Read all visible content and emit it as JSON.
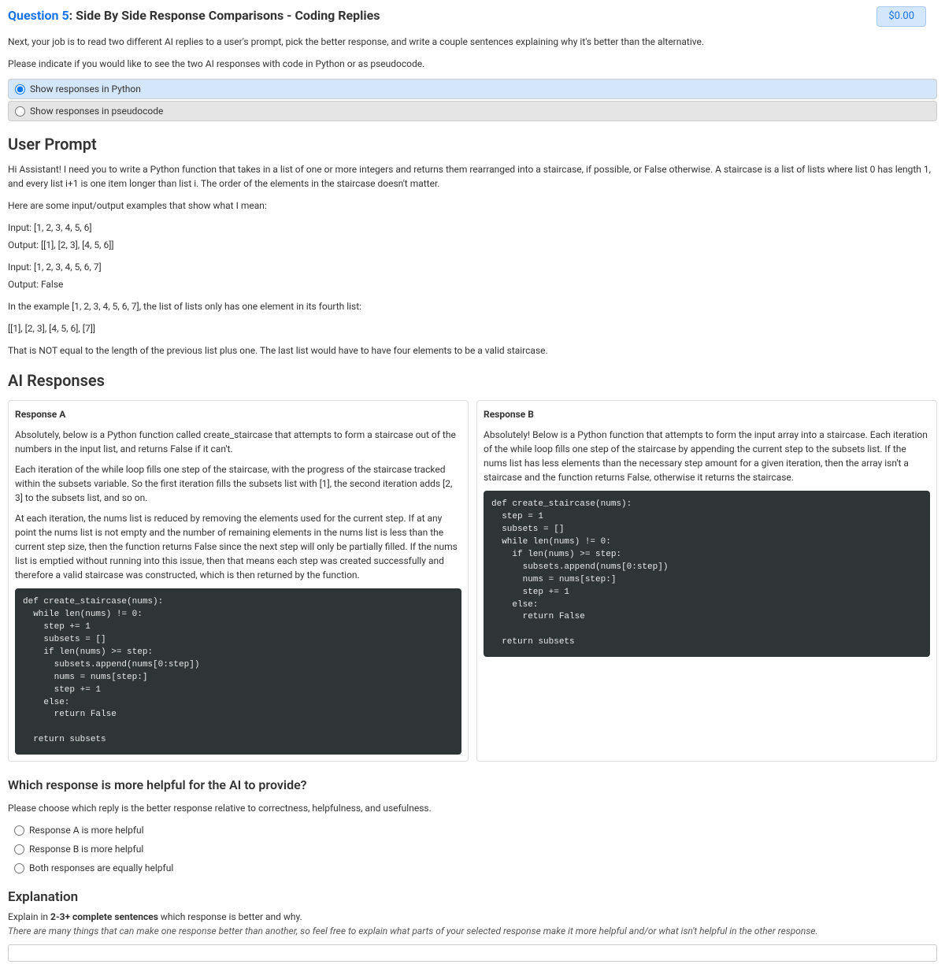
{
  "price": "$0.00",
  "question": {
    "number": "Question 5",
    "title": ": Side By Side Response Comparisons - Coding Replies"
  },
  "instructions": {
    "line1": "Next, your job is to read two different AI replies to a user's prompt, pick the better response, and write a couple sentences explaining why it's better than the alternative.",
    "line2": "Please indicate if you would like to see the two AI responses with code in Python or as pseudocode."
  },
  "codeFormatOptions": {
    "opt1": "Show responses in Python",
    "opt2": "Show responses in pseudocode"
  },
  "userPrompt": {
    "title": "User Prompt",
    "line1": "Hi Assistant! I need you to write a Python function that takes in a list of one or more integers and returns them rearranged into a staircase, if possible, or False otherwise. A staircase is a list of lists where list 0 has length 1, and every list i+1 is one item longer than list i. The order of the elements in the staircase doesn't matter.",
    "line2": "Here are some input/output examples that show what I mean:",
    "example1a": "Input: [1, 2, 3, 4, 5, 6]",
    "example1b": "Output: [[1], [2, 3], [4, 5, 6]]",
    "example2a": "Input: [1, 2, 3, 4, 5, 6, 7]",
    "example2b": "Output: False",
    "line3": "In the example [1, 2, 3, 4, 5, 6, 7], the list of lists only has one element in its fourth list:",
    "line4": "[[1], [2, 3], [4, 5, 6], [7]]",
    "line5": "That is NOT equal to the length of the previous list plus one. The last list would have to have four elements to be a valid staircase."
  },
  "aiResponses": {
    "title": "AI Responses",
    "responseA": {
      "header": "Response A",
      "p1": "Absolutely, below is a Python function called create_staircase that attempts to form a staircase out of the numbers in the input list, and returns False if it can't.",
      "p2": "Each iteration of the while loop fills one step of the staircase, with the progress of the staircase tracked within the subsets variable. So the first iteration fills the subsets list with [1], the second iteration adds [2, 3] to the subsets list, and so on.",
      "p3": "At each iteration, the nums list is reduced by removing the elements used for the current step. If at any point the nums list is not empty and the number of remaining elements in the nums list is less than the current step size, then the function returns False since the next step will only be partially filled. If the nums list is emptied without running into this issue, then that means each step was created successfully and therefore a valid staircase was constructed, which is then returned by the function.",
      "code": "def create_staircase(nums):\n  while len(nums) != 0:\n    step += 1\n    subsets = []\n    if len(nums) >= step:\n      subsets.append(nums[0:step])\n      nums = nums[step:]\n      step += 1\n    else:\n      return False\n\n  return subsets"
    },
    "responseB": {
      "header": "Response B",
      "p1": "Absolutely! Below is a Python function that attempts to form the input array into a staircase. Each iteration of the while loop fills one step of the staircase by appending the current step to the subsets list. If the nums list has less elements than the necessary step amount for a given iteration, then the array isn't a staircase and the function returns False, otherwise it returns the staircase.",
      "code": "def create_staircase(nums):\n  step = 1\n  subsets = []\n  while len(nums) != 0:\n    if len(nums) >= step:\n      subsets.append(nums[0:step])\n      nums = nums[step:]\n      step += 1\n    else:\n      return False\n\n  return subsets"
    }
  },
  "helpfulSection": {
    "question": "Which response is more helpful for the AI to provide?",
    "instruction": "Please choose which reply is the better response relative to correctness, helpfulness, and usefulness.",
    "optA": "Response A is more helpful",
    "optB": "Response B is more helpful",
    "optBoth": "Both responses are equally helpful"
  },
  "explanation": {
    "header": "Explanation",
    "line1a": "Explain in ",
    "line1b": "2-3+ complete sentences",
    "line1c": " which response is better and why.",
    "line2": "There are many things that can make one response better than another, so feel free to explain what parts of your selected response make it more helpful and/or what isn't helpful in the other response."
  }
}
